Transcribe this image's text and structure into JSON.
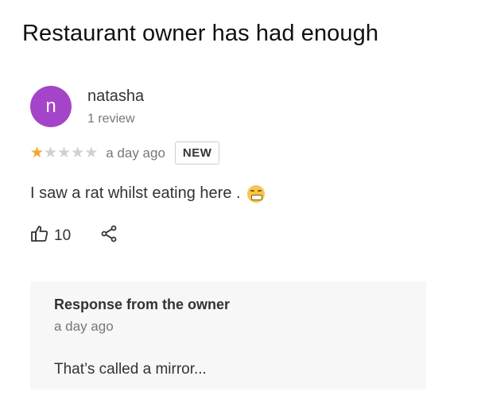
{
  "caption": "Restaurant owner has had enough",
  "review": {
    "avatar_letter": "n",
    "avatar_color": "#a445c9",
    "author": "natasha",
    "author_stats": "1 review",
    "rating": 1,
    "rating_max": 5,
    "time": "a day ago",
    "badge": "NEW",
    "text": "I saw a rat whilst eating here .",
    "emoji_icon": "grimacing-face-emoji",
    "likes": "10",
    "like_icon": "thumbs-up-icon",
    "share_icon": "share-icon"
  },
  "owner_response": {
    "title": "Response from the owner",
    "time": "a day ago",
    "text": "That’s called a mirror..."
  },
  "colors": {
    "star_filled": "#f2a531",
    "star_empty": "#d0d0d0"
  }
}
